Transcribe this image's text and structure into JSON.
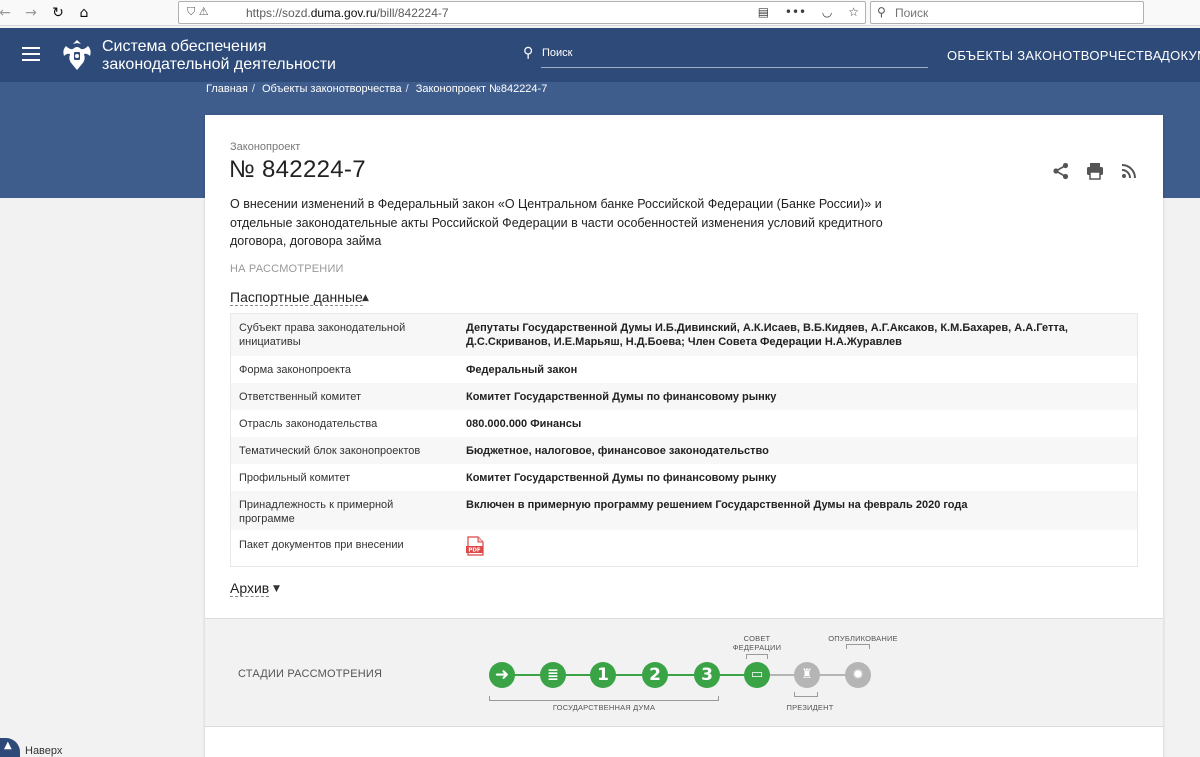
{
  "browser": {
    "url_prefix": "https://sozd.",
    "url_domain": "duma.gov.ru",
    "url_path": "/bill/842224-7",
    "search_placeholder": "Поиск",
    "menu_dots": "•••"
  },
  "header": {
    "brand_line1": "Система обеспечения",
    "brand_line2": "законодательной деятельности",
    "search_placeholder": "Поиск",
    "nav": [
      "ОБЪЕКТЫ ЗАКОНОТВОРЧЕСТВА",
      "ДОКУМ"
    ]
  },
  "breadcrumbs": [
    "Главная",
    "Объекты законотворчества",
    "Законопроект №842224-7"
  ],
  "bill": {
    "type": "Законопроект",
    "number": "№ 842224-7",
    "title": "О внесении изменений в Федеральный закон «О Центральном банке Российской Федерации (Банке России)» и отдельные законодательные акты Российской Федерации в части особенностей изменения условий кредитного договора, договора займа",
    "status": "НА РАССМОТРЕНИИ"
  },
  "passport": {
    "label": "Паспортные данные",
    "rows": [
      {
        "key": "Субъект права законодательной инициативы",
        "value": "Депутаты Государственной Думы И.Б.Дивинский, А.К.Исаев, В.Б.Кидяев, А.Г.Аксаков, К.М.Бахарев, А.А.Гетта, Д.С.Скриванов, И.Е.Марьяш, Н.Д.Боева; Член Совета Федерации Н.А.Журавлев"
      },
      {
        "key": "Форма законопроекта",
        "value": "Федеральный закон"
      },
      {
        "key": "Ответственный комитет",
        "value": "Комитет Государственной Думы по финансовому рынку"
      },
      {
        "key": "Отрасль законодательства",
        "value": "080.000.000 Финансы"
      },
      {
        "key": "Тематический блок законопроектов",
        "value": "Бюджетное, налоговое, финансовое законодательство"
      },
      {
        "key": "Профильный комитет",
        "value": "Комитет Государственной Думы по финансовому рынку"
      },
      {
        "key": "Принадлежность к примерной программе",
        "value": "Включен в примерную программу решением Государственной Думы на февраль 2020 года"
      },
      {
        "key": "Пакет документов при внесении",
        "value": ""
      }
    ],
    "pdf_label": "PDF"
  },
  "archive": {
    "label": "Архив"
  },
  "stages": {
    "label": "СТАДИИ РАССМОТРЕНИЯ",
    "steps": [
      {
        "symbol": "➜",
        "state": "done"
      },
      {
        "symbol": "≣",
        "state": "done"
      },
      {
        "symbol": "1",
        "state": "done"
      },
      {
        "symbol": "2",
        "state": "done"
      },
      {
        "symbol": "3",
        "state": "done"
      },
      {
        "symbol": "▭",
        "state": "done"
      },
      {
        "symbol": "♜",
        "state": "todo"
      },
      {
        "symbol": "✹",
        "state": "todo"
      }
    ],
    "cap_duma": "ГОСУДАРСТВЕННАЯ ДУМА",
    "cap_federation_1": "СОВЕТ",
    "cap_federation_2": "ФЕДЕРАЦИИ",
    "cap_president": "ПРЕЗИДЕНТ",
    "cap_published": "ОПУБЛИКОВАНИЕ",
    "colors": {
      "done": "#3aa346",
      "todo": "#b5b5b5"
    }
  },
  "back_top": {
    "label": "Наверх"
  }
}
